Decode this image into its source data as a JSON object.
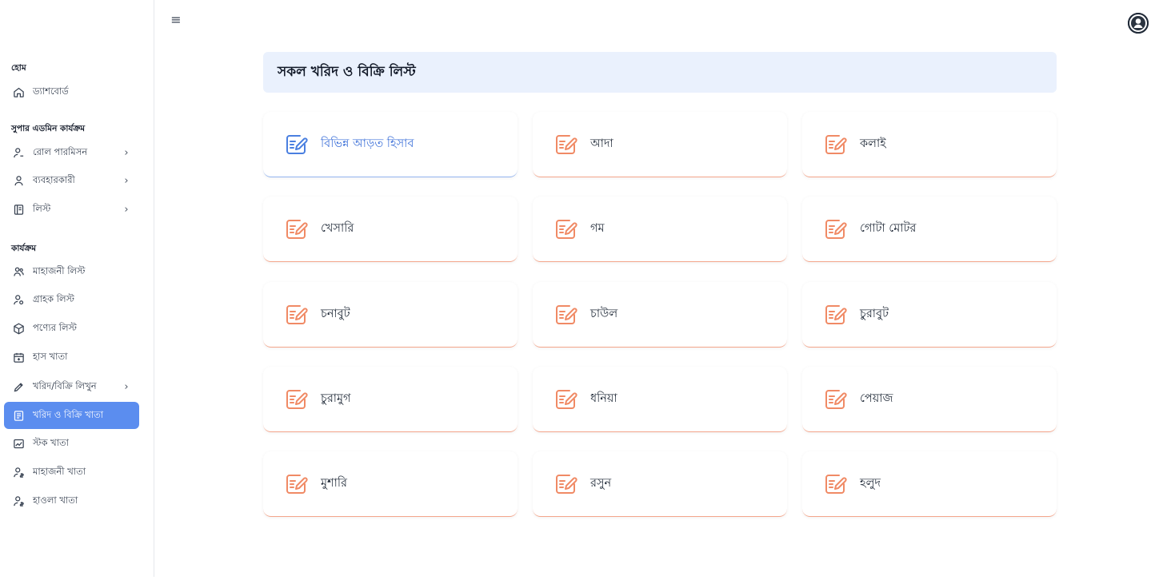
{
  "sidebar": {
    "sections": [
      {
        "title": "হোম"
      },
      {
        "title": "সুপার এডমিন কার্যক্রম"
      },
      {
        "title": "কার্যক্রম"
      }
    ],
    "items": [
      {
        "label": "ড্যাশবোর্ড",
        "icon": "home-icon"
      },
      {
        "label": "রোল পারমিসন",
        "icon": "user-lock-icon",
        "chevron": "›"
      },
      {
        "label": "ব্যবহারকারী",
        "icon": "user-icon",
        "chevron": "›"
      },
      {
        "label": "লিস্ট",
        "icon": "book-icon",
        "chevron": "›"
      },
      {
        "label": "মাহাজনী লিস্ট",
        "icon": "users-icon"
      },
      {
        "label": "গ্রাহক লিস্ট",
        "icon": "user-gear-icon"
      },
      {
        "label": "পণ্যের লিস্ট",
        "icon": "cube-icon"
      },
      {
        "label": "হাস খাতা",
        "icon": "calendar-icon"
      },
      {
        "label": "খরিদ/বিক্রি লিখুন",
        "icon": "pencil-icon",
        "chevron": "›"
      },
      {
        "label": "খরিদ ও বিক্রি খাতা",
        "icon": "ledger-icon",
        "active": true
      },
      {
        "label": "স্টক খাতা",
        "icon": "chart-icon"
      },
      {
        "label": "মাহাজনী খাতা",
        "icon": "user-money-icon"
      },
      {
        "label": "হাওলা খাতা",
        "icon": "user-money-icon"
      }
    ]
  },
  "header": {
    "menu_icon": "≡"
  },
  "main": {
    "title": "সকল খরিদ ও বিক্রি লিস্ট",
    "cards": [
      {
        "label": "বিভিন্ন আড়ত হিসাব",
        "selected": true
      },
      {
        "label": "আদা"
      },
      {
        "label": "কলাই"
      },
      {
        "label": "খেসারি"
      },
      {
        "label": "গম"
      },
      {
        "label": "গোটা মোটর"
      },
      {
        "label": "চনাবুট"
      },
      {
        "label": "চাউল"
      },
      {
        "label": "চুরাবুট"
      },
      {
        "label": "চুরামুগ"
      },
      {
        "label": "ধনিয়া"
      },
      {
        "label": "পেয়াজ"
      },
      {
        "label": "মুশারি"
      },
      {
        "label": "রসুন"
      },
      {
        "label": "হলুদ"
      }
    ]
  },
  "colors": {
    "accent": "#5b8def",
    "card_icon": "#f08a65",
    "card_icon_selected": "#4a7fe0",
    "title_bg": "#eaf1fd"
  }
}
